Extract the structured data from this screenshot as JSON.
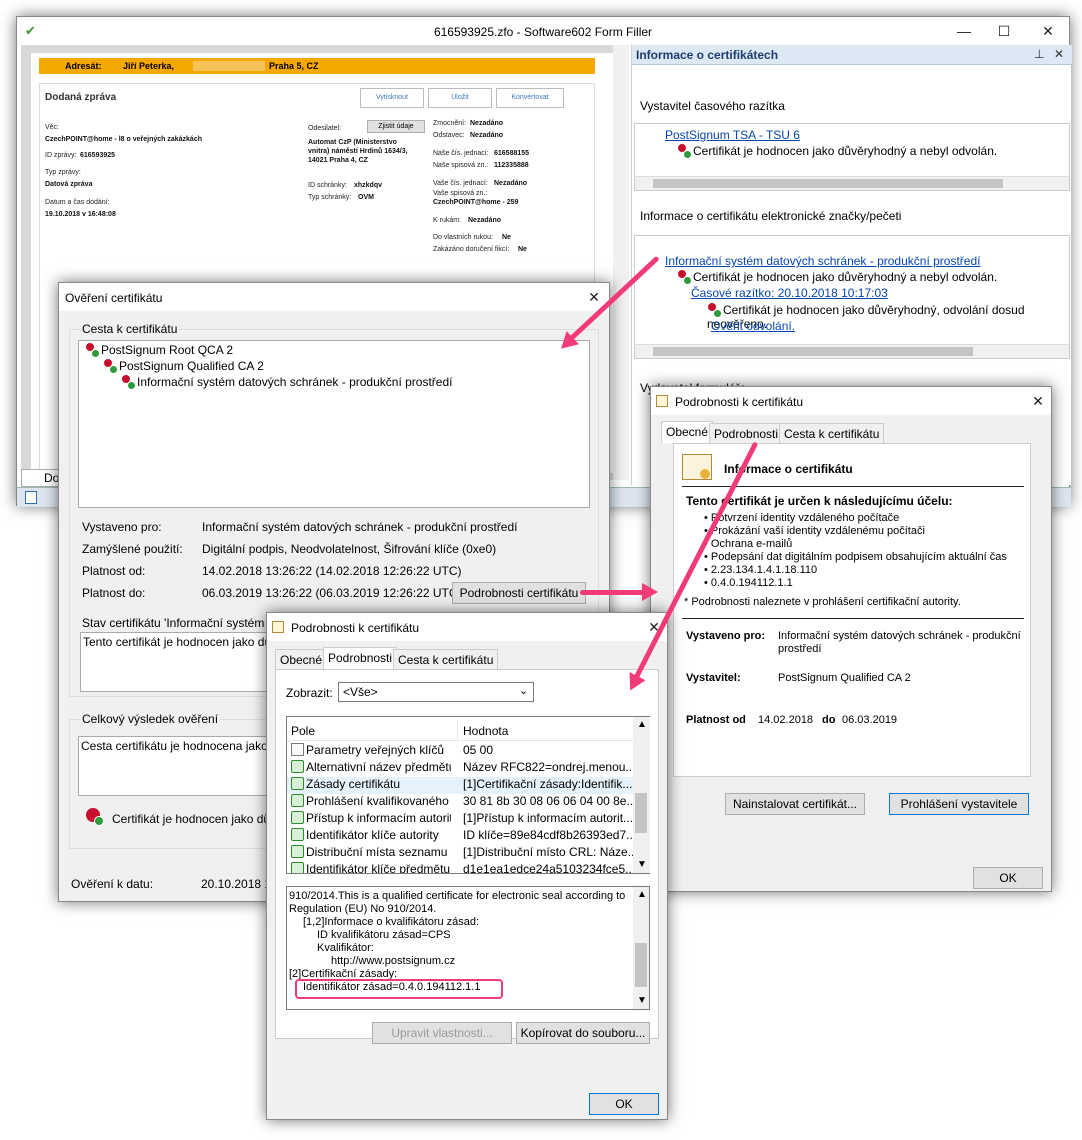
{
  "main_window": {
    "title": "616593925.zfo - Software602 Form Filler",
    "tab_label": "Doc"
  },
  "form": {
    "addressee_label": "Adresát:",
    "addressee_name": "Jiří Peterka,",
    "addressee_city": "Praha 5, CZ",
    "section_title": "Dodaná zpráva",
    "btn_vytisknout": "Vytisknout",
    "btn_ulozit": "Uložit",
    "btn_konvertovat": "Konvertovat",
    "vec_label": "Věc:",
    "vec_value": "CzechPOINT@home - l8 o veřejných zakázkách",
    "id_label": "ID zprávy:",
    "id_value": "616593925",
    "typ_label": "Typ zprávy:",
    "typ_value": "Datová zpráva",
    "datum_label": "Datum a čas dodání:",
    "datum_value": "19.10.2018 v 16:48:08",
    "odesilatel_label": "Odesilatel:",
    "zjistit_btn": "Zjistit údaje",
    "odesilatel_value": "Automat CzP (Ministerstvo vnitra) náměstí Hrdinů 1634/3, 14021 Praha 4, CZ",
    "id_schranky_label": "ID schránky:",
    "id_schranky_value": "xhzkdqv",
    "typ_schranky_label": "Typ schránky:",
    "typ_schranky_value": "OVM",
    "zmocneni": "Zmocnění:",
    "odstavec": "Odstavec:",
    "nezadano": "Nezadáno",
    "nase_cj": "Naše čís. jednací:",
    "nase_cj_val": "616588155",
    "nase_sz": "Naše spisová zn.:",
    "nase_sz_val": "112335888",
    "vase_cj": "Vaše čís. jednací:",
    "vase_sz": "Vaše spisová zn.:",
    "vase_sz_val": "CzechPOINT@home - 259",
    "k_rukam": "K rukám:",
    "do_vlastnich": "Do vlastních rukou:",
    "zakazano": "Zakázáno doručení fikcí:",
    "ne": "Ne"
  },
  "cert_info_panel": {
    "title": "Informace o certifikátech",
    "section1": "Vystavitel časového razítka",
    "tsa_link": "PostSignum TSA - TSU 6",
    "trusted_not_revoked": "Certifikát je hodnocen jako důvěryhodný a nebyl odvolán.",
    "section2": "Informace o certifikátu elektronické značky/pečeti",
    "isds_link": "Informační systém datových schránek - produkční prostředí",
    "timestamp_link": "Časové razítko: 20.10.2018 10:17:03",
    "trusted_unverified": "Certifikát je hodnocen jako důvěryhodný, odvolání dosud neověřeno.",
    "verify_link": "Ověřit odvolání.",
    "section3": "Vydavatel formuláře"
  },
  "verify_dialog": {
    "title": "Ověření certifikátu",
    "path_group": "Cesta k certifikátu",
    "tree": [
      "PostSignum Root QCA 2",
      "PostSignum Qualified CA 2",
      "Informační systém datových schránek - produkční prostředí"
    ],
    "issued_to_label": "Vystaveno pro:",
    "issued_to": "Informační systém datových schránek - produkční prostředí",
    "usage_label": "Zamýšlené použití:",
    "usage": "Digitální podpis, Neodvolatelnost, Šifrování klíče (0xe0)",
    "valid_from_label": "Platnost od:",
    "valid_from": "14.02.2018 13:26:22  (14.02.2018 12:26:22 UTC)",
    "valid_to_label": "Platnost do:",
    "valid_to": "06.03.2019 13:26:22  (06.03.2019 12:26:22 UTC)",
    "details_btn": "Podrobnosti certifikátu",
    "status_group": "Stav certifikátu 'Informační systém dato",
    "status_text": "Tento certifikát je hodnocen jako důvě",
    "result_group": "Celkový výsledek ověření",
    "result_text": "Cesta certifikátu je hodnocena jako dů",
    "result_seal_text": "Certifikát je hodnocen jako důvě",
    "verified_at_label": "Ověření k datu:",
    "verified_at": "20.10.2018 1"
  },
  "details_general": {
    "title": "Podrobnosti k certifikátu",
    "tabs": [
      "Obecné",
      "Podrobnosti",
      "Cesta k certifikátu"
    ],
    "info_title": "Informace o certifikátu",
    "purpose_heading": "Tento certifikát je určen k následujícímu účelu:",
    "purposes": [
      "Potvrzení identity vzdáleného počítače",
      "Prokázání vaší identity vzdálenému počítači",
      "Ochrana e-mailů",
      "Podepsání dat digitálním podpisem obsahujícím aktuální čas",
      "2.23.134.1.4.1.18.110",
      "0.4.0.194112.1.1"
    ],
    "note": "* Podrobnosti naleznete v prohlášení certifikační autority.",
    "issued_to_label": "Vystaveno pro:",
    "issued_to": "Informační systém datových schránek - produkční prostředí",
    "issuer_label": "Vystavitel:",
    "issuer": "PostSignum Qualified CA 2",
    "validity_label": "Platnost od",
    "validity_from": "14.02.2018",
    "validity_do": "do",
    "validity_to": "06.03.2019",
    "install_btn": "Nainstalovat certifikát...",
    "statement_btn": "Prohlášení vystavitele",
    "ok_btn": "OK"
  },
  "details_fields": {
    "title": "Podrobnosti k certifikátu",
    "tabs": [
      "Obecné",
      "Podrobnosti",
      "Cesta k certifikátu"
    ],
    "show_label": "Zobrazit:",
    "show_value": "<Vše>",
    "col_field": "Pole",
    "col_value": "Hodnota",
    "rows": [
      {
        "field": "Parametry veřejných klíčů",
        "value": "05 00"
      },
      {
        "field": "Alternativní název předmětu",
        "value": "Název RFC822=ondrej.menou..."
      },
      {
        "field": "Zásady certifikátu",
        "value": "[1]Certifikační zásady:Identifik..."
      },
      {
        "field": "Prohlášení kvalifikovaného c...",
        "value": "30 81 8b 30 08 06 06 04 00 8e..."
      },
      {
        "field": "Přístup k informacím autority",
        "value": "[1]Přístup k informacím autorit..."
      },
      {
        "field": "Identifikátor klíče autority",
        "value": "ID klíče=89e84cdf8b26393ed7..."
      },
      {
        "field": "Distribuční místa seznamu o...",
        "value": "[1]Distribuční místo CRL: Náze..."
      },
      {
        "field": "Identifikátor klíče předmětu",
        "value": "d1e1ea1edce24a5103234fce5..."
      }
    ],
    "detail_lines": [
      "910/2014.This is a qualified certificate for electronic seal according to",
      "Regulation (EU) No 910/2014.",
      "[1,2]Informace o kvalifikátoru zásad:",
      "ID kvalifikátoru zásad=CPS",
      "Kvalifikátor:",
      "http://www.postsignum.cz",
      "[2]Certifikační zásady:",
      "Identifikátor zásad=0.4.0.194112.1.1"
    ],
    "edit_btn": "Upravit vlastnosti...",
    "copy_btn": "Kopírovat do souboru...",
    "ok_btn": "OK"
  },
  "colors": {
    "accent_arrow": "#f03a7a",
    "addressee_bar": "#f5a800",
    "link": "#0645ad"
  }
}
